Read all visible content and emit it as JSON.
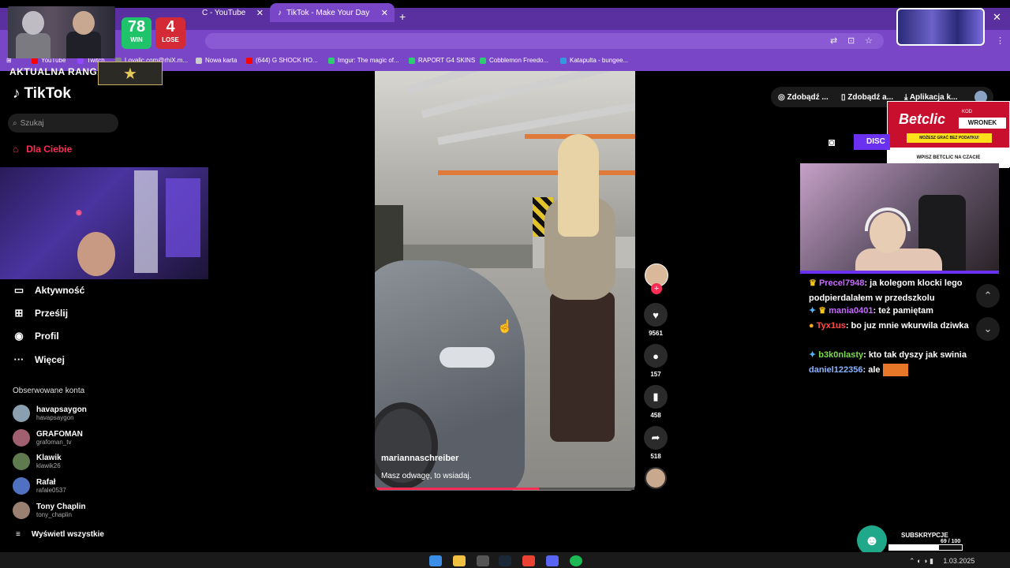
{
  "browser": {
    "tabs": [
      {
        "label": "C - YouTube"
      },
      {
        "label": "TikTok - Make Your Day"
      }
    ],
    "bookmarks": [
      {
        "label": "YouTube",
        "color": "#ff0000"
      },
      {
        "label": "Twitch",
        "color": "#9146ff"
      },
      {
        "label": "Loyalic.com@rhiX.m...",
        "color": "#888888"
      },
      {
        "label": "Nowa karta",
        "color": "#cccccc"
      },
      {
        "label": "(644) G SHOCK HO...",
        "color": "#ff0000"
      },
      {
        "label": "Imgur: The magic of...",
        "color": "#2ecc71"
      },
      {
        "label": "RAPORT G4 SKINS",
        "color": "#2ecc71"
      },
      {
        "label": "Cobblemon Freedo...",
        "color": "#2ecc71"
      },
      {
        "label": "Katapulta - bungee...",
        "color": "#3498db"
      }
    ]
  },
  "overlay": {
    "wins": "78",
    "win_label": "WIN",
    "losses": "4",
    "lose_label": "LOSE",
    "rank_label": "AKTUALNA RANGA:"
  },
  "tiktok": {
    "logo": "TikTok",
    "search_placeholder": "Szukaj",
    "nav": {
      "home": "Dla Ciebie",
      "activity": "Aktywność",
      "upload": "Prześlij",
      "profile": "Profil",
      "more": "Więcej"
    },
    "followed_header": "Obserwowane konta",
    "followed": [
      {
        "name": "havapsaygon",
        "username": "havapsaygon",
        "color": "#8aa0b0"
      },
      {
        "name": "GRAFOMAN",
        "username": "grafoman_tv",
        "color": "#a06070"
      },
      {
        "name": "Klawik",
        "username": "klawik26",
        "color": "#607a50"
      },
      {
        "name": "Rafał",
        "username": "rafale0537",
        "color": "#5070c0"
      },
      {
        "name": "Tony Chaplin",
        "username": "tony_chaplin",
        "color": "#9a8070"
      }
    ],
    "see_all": "Wyświetl wszystkie",
    "video": {
      "username": "mariannaschreiber",
      "caption": "Masz odwagę, to wsiadaj.",
      "progress": 0.63
    },
    "actions": {
      "likes": "9561",
      "comments": "157",
      "saves": "458",
      "shares": "518"
    },
    "topright": {
      "get_coins": "Zdobądź ...",
      "get_app": "Zdobądź a...",
      "app": "Aplikacja k..."
    }
  },
  "sponsor": {
    "brand": "Betclic",
    "kod_label": "KOD",
    "code": "WRONEK",
    "tagline": "MOŻESZ GRAĆ BEZ PODATKU!",
    "footer": "WPISZ BETCLIC NA CZACIE"
  },
  "discord_label": "DISC",
  "chat": [
    {
      "user": "Precel7948",
      "text": ": ja kolegom klocki lego podpierdalałem w przedszkolu"
    },
    {
      "user": "mania0401",
      "text": ": też pamiętam"
    },
    {
      "user": "Tyx1us",
      "text": ": bo juz mnie wkurwila dziwka"
    },
    {
      "user": "b3k0nlasty",
      "text": ": kto tak dyszy jak swinia"
    },
    {
      "user": "daniel122356",
      "text": ": ale"
    }
  ],
  "subs": {
    "label": "SUBSKRYPCJE",
    "count": "69 / 100",
    "fraction": 0.69
  },
  "tray": {
    "date": "1.03.2025"
  }
}
